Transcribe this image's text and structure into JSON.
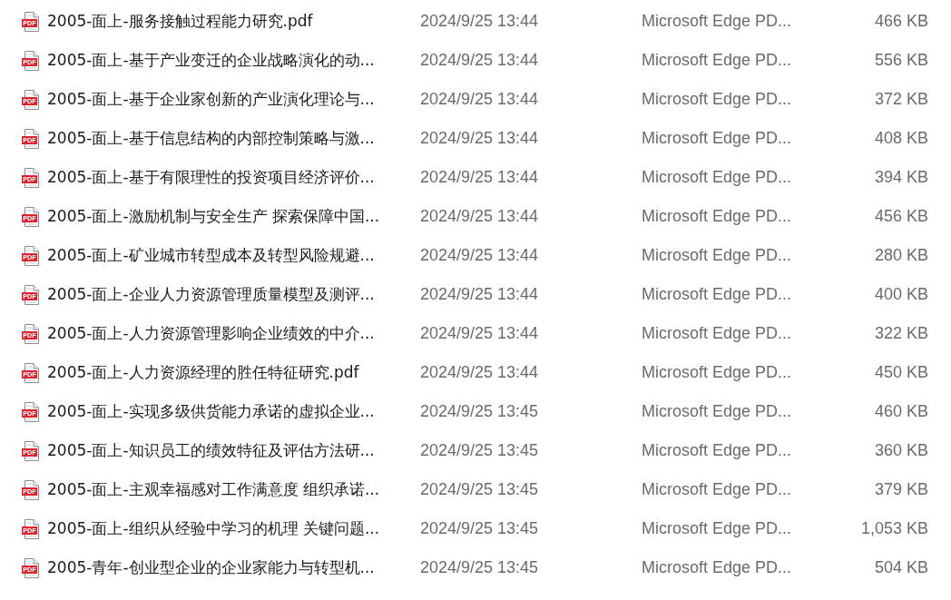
{
  "file_list": {
    "rows": [
      {
        "icon_label": "PDF",
        "column_1": "2005-面上-服务接触过程能力研究.pdf",
        "column_2": "2024/9/25 13:44",
        "column_3": "Microsoft Edge PD...",
        "column_4": "466 KB"
      },
      {
        "icon_label": "PDF",
        "column_1": "2005-面上-基于产业变迁的企业战略演化的动...",
        "column_2": "2024/9/25 13:44",
        "column_3": "Microsoft Edge PD...",
        "column_4": "556 KB"
      },
      {
        "icon_label": "PDF",
        "column_1": "2005-面上-基于企业家创新的产业演化理论与...",
        "column_2": "2024/9/25 13:44",
        "column_3": "Microsoft Edge PD...",
        "column_4": "372 KB"
      },
      {
        "icon_label": "PDF",
        "column_1": "2005-面上-基于信息结构的内部控制策略与激...",
        "column_2": "2024/9/25 13:44",
        "column_3": "Microsoft Edge PD...",
        "column_4": "408 KB"
      },
      {
        "icon_label": "PDF",
        "column_1": "2005-面上-基于有限理性的投资项目经济评价...",
        "column_2": "2024/9/25 13:44",
        "column_3": "Microsoft Edge PD...",
        "column_4": "394 KB"
      },
      {
        "icon_label": "PDF",
        "column_1": "2005-面上-激励机制与安全生产 探索保障中国...",
        "column_2": "2024/9/25 13:44",
        "column_3": "Microsoft Edge PD...",
        "column_4": "456 KB"
      },
      {
        "icon_label": "PDF",
        "column_1": "2005-面上-矿业城市转型成本及转型风险规避...",
        "column_2": "2024/9/25 13:44",
        "column_3": "Microsoft Edge PD...",
        "column_4": "280 KB"
      },
      {
        "icon_label": "PDF",
        "column_1": "2005-面上-企业人力资源管理质量模型及测评...",
        "column_2": "2024/9/25 13:44",
        "column_3": "Microsoft Edge PD...",
        "column_4": "400 KB"
      },
      {
        "icon_label": "PDF",
        "column_1": "2005-面上-人力资源管理影响企业绩效的中介...",
        "column_2": "2024/9/25 13:44",
        "column_3": "Microsoft Edge PD...",
        "column_4": "322 KB"
      },
      {
        "icon_label": "PDF",
        "column_1": "2005-面上-人力资源经理的胜任特征研究.pdf",
        "column_2": "2024/9/25 13:44",
        "column_3": "Microsoft Edge PD...",
        "column_4": "450 KB"
      },
      {
        "icon_label": "PDF",
        "column_1": "2005-面上-实现多级供货能力承诺的虚拟企业...",
        "column_2": "2024/9/25 13:45",
        "column_3": "Microsoft Edge PD...",
        "column_4": "460 KB"
      },
      {
        "icon_label": "PDF",
        "column_1": "2005-面上-知识员工的绩效特征及评估方法研...",
        "column_2": "2024/9/25 13:45",
        "column_3": "Microsoft Edge PD...",
        "column_4": "360 KB"
      },
      {
        "icon_label": "PDF",
        "column_1": "2005-面上-主观幸福感对工作满意度 组织承诺...",
        "column_2": "2024/9/25 13:45",
        "column_3": "Microsoft Edge PD...",
        "column_4": "379 KB"
      },
      {
        "icon_label": "PDF",
        "column_1": "2005-面上-组织从经验中学习的机理 关键问题...",
        "column_2": "2024/9/25 13:45",
        "column_3": "Microsoft Edge PD...",
        "column_4": "1,053 KB"
      },
      {
        "icon_label": "PDF",
        "column_1": "2005-青年-创业型企业的企业家能力与转型机...",
        "column_2": "2024/9/25 13:45",
        "column_3": "Microsoft Edge PD...",
        "column_4": "504 KB"
      }
    ]
  }
}
